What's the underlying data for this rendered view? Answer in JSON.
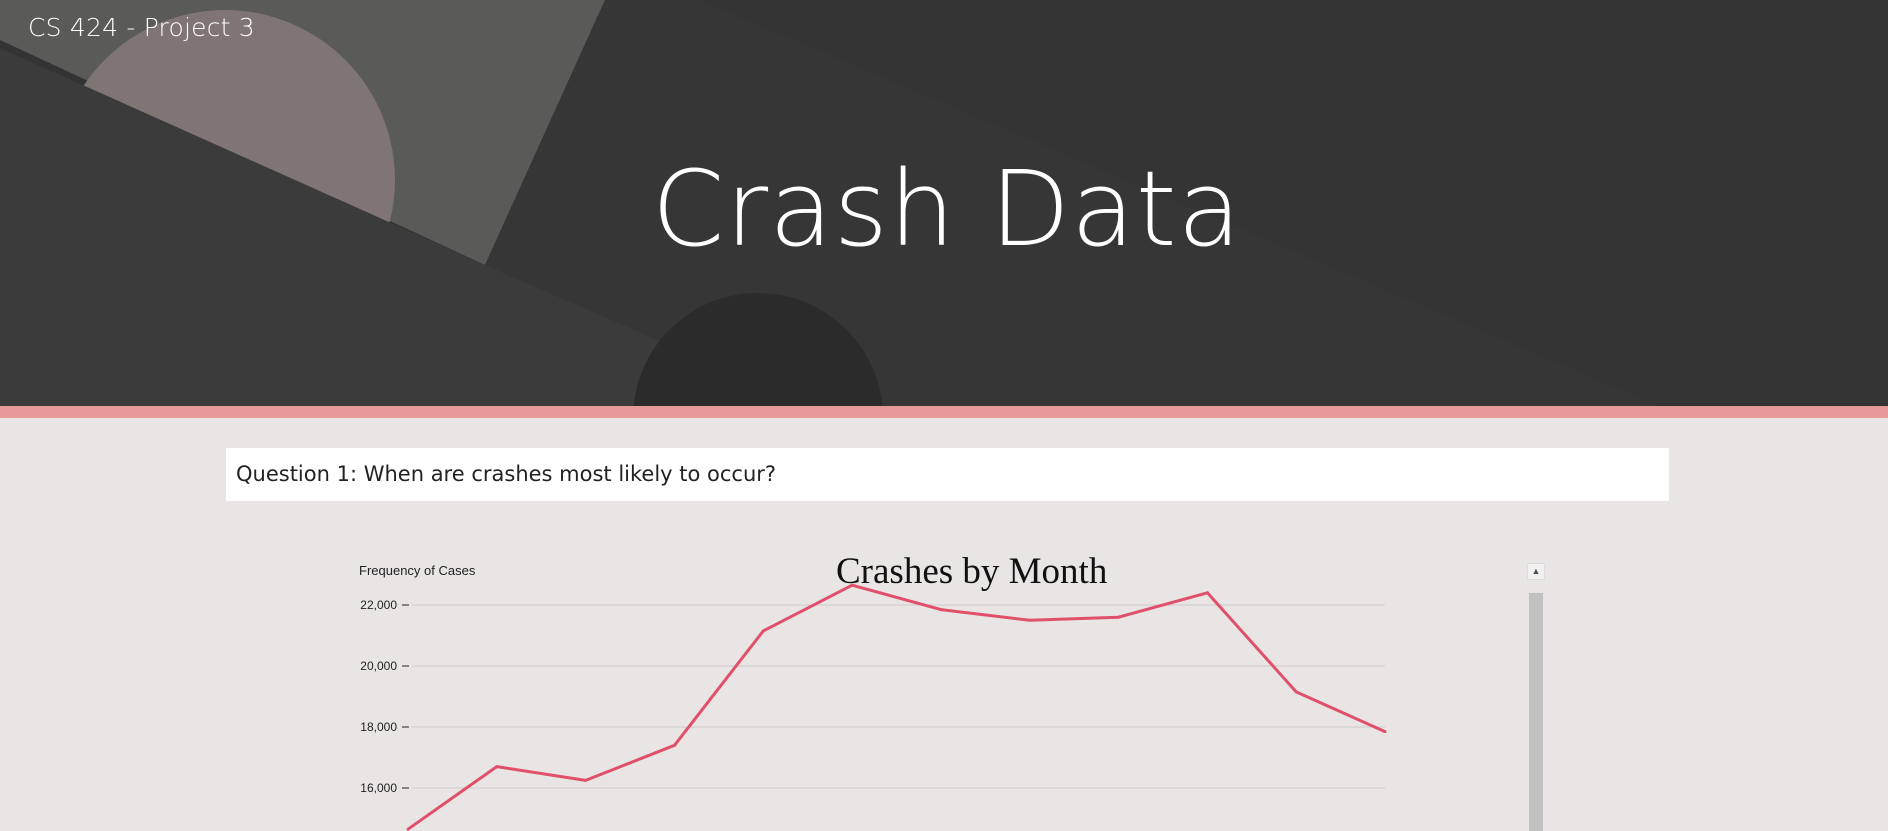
{
  "header": {
    "site_title": "CS 424 - Project 3",
    "page_title": "Crash Data"
  },
  "colors": {
    "hero_background": "#383838",
    "accent_bar": "#e89898",
    "page_background": "#e9e5e5",
    "line": "#e0506a"
  },
  "question": {
    "text": "Question 1: When are crashes most likely to occur?"
  },
  "chart_data": {
    "type": "line",
    "title": "Crashes by Month",
    "ylabel": "Frequency of Cases",
    "xlabel": "",
    "y_ticks": [
      "22,000",
      "20,000",
      "18,000",
      "16,000"
    ],
    "y_tick_values": [
      22000,
      20000,
      18000,
      16000
    ],
    "grid": true,
    "series": [
      {
        "values": [
          14650,
          16700,
          16250,
          17400,
          21150,
          22650,
          21850,
          21500,
          21600,
          22400,
          19150,
          17850
        ]
      }
    ]
  },
  "scrollbar": {
    "up_arrow_icon": "triangle-up-icon"
  }
}
